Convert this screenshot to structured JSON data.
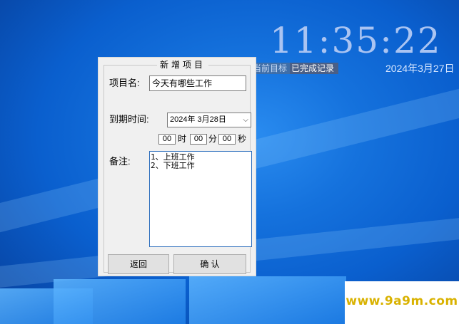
{
  "clock": {
    "time": "11:35:22",
    "date": "2024年3月27日",
    "link_current_goal": "当前目标",
    "link_completed": "已完成记录"
  },
  "dialog": {
    "title": "新增项目",
    "name_label": "项目名:",
    "name_value": "今天有哪些工作",
    "due_label": "到期时间:",
    "due_date": "2024年 3月28日",
    "hour": "00",
    "hour_unit": "时",
    "minute": "00",
    "minute_unit": "分",
    "second": "00",
    "second_unit": "秒",
    "note_label": "备注:",
    "note_value": "1、上班工作\n2、下班工作",
    "back_button": "返回",
    "confirm_button": "确 认"
  },
  "watermark": {
    "text": "www.9a9m.com"
  }
}
